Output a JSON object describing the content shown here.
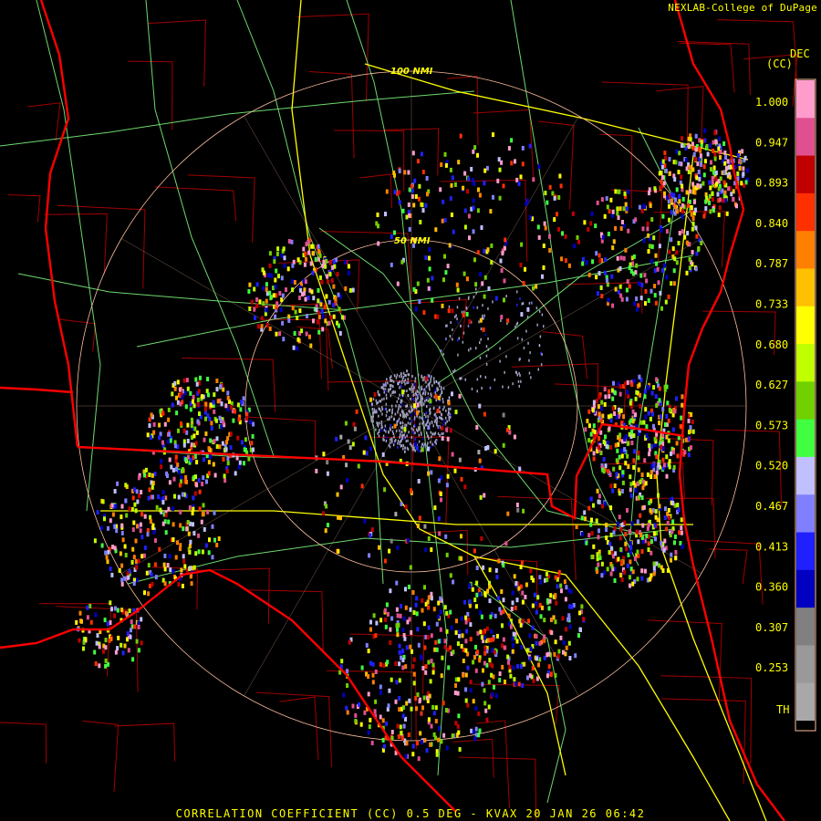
{
  "credit": "NEXLAB-College of DuPage",
  "footer": "CORRELATION COEFFICIENT (CC) 0.5 DEG - KVAX 20 JAN 26 06:42",
  "rings": [
    {
      "label": "100 NMI"
    },
    {
      "label": "50 NMI"
    }
  ],
  "legend": {
    "title_line1": "DEC",
    "title_line2": "(CC)",
    "ticks": [
      "1.000",
      "0.947",
      "0.893",
      "0.840",
      "0.787",
      "0.733",
      "0.680",
      "0.627",
      "0.573",
      "0.520",
      "0.467",
      "0.413",
      "0.360",
      "0.307",
      "0.253"
    ],
    "threshold_label": "TH",
    "colors": [
      "#ff9ccc",
      "#e05090",
      "#c00000",
      "#ff3000",
      "#ff8000",
      "#ffc000",
      "#ffff00",
      "#c0ff00",
      "#70d000",
      "#40ff40",
      "#c0c0ff",
      "#8080ff",
      "#2020ff",
      "#0000c0",
      "#808080",
      "#999999",
      "#a8a8a8"
    ]
  },
  "colors": {
    "state_border": "#ff0000",
    "county_border": "#a00000",
    "interstate": "#ffff00",
    "highway": "#80ff80",
    "range_ring": "#ffc0a0",
    "text": "#ffff00"
  }
}
